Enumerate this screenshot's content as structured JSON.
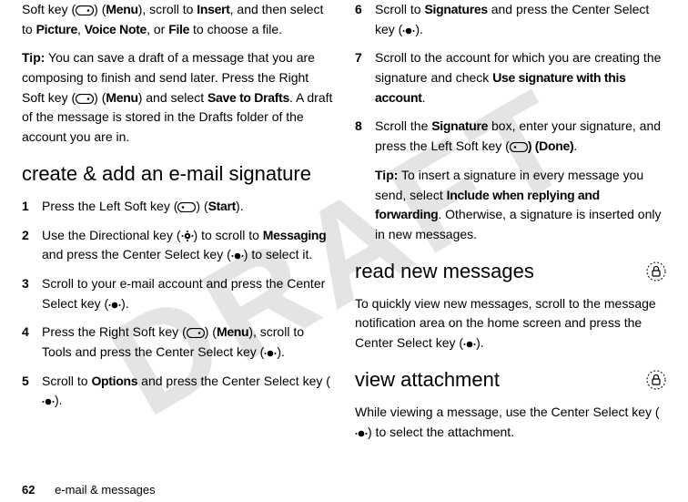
{
  "watermark": "DRAFT",
  "left": {
    "top_continuation": "Soft key (",
    "top_continuation_after_icon": ") (",
    "menu_label": "Menu",
    "top_continuation2": "), scroll to  ",
    "insert_label": "Insert",
    "top_continuation3": ", and then select to ",
    "picture_label": "Picture",
    "voice_note_label": "Voice Note",
    "file_label": "File",
    "top_continuation4": " to choose a file.",
    "tip_label": "Tip:",
    "tip_body_pre": " You can save a draft of a message that you are composing to finish and send later. Press the Right Soft key (",
    "tip_body_mid1": ") (",
    "tip_body_mid2": ") and select ",
    "save_drafts_label": "Save to Drafts",
    "tip_body_end": ". A draft of the message is stored in the Drafts folder of the account you are in.",
    "section_heading": "create & add an e-mail signature",
    "steps": {
      "s1_pre": "Press the Left Soft key (",
      "s1_mid": ") (",
      "start_label": "Start",
      "s1_end": ").",
      "s2_pre": "Use the Directional key (",
      "s2_mid1": ") to scroll to ",
      "messaging_label": "Messaging",
      "s2_mid2": " and press the Center Select key (",
      "s2_end": ") to select it.",
      "s3_pre": "Scroll to your e-mail account and press the Center Select key (",
      "s3_end": ").",
      "s4_pre": "Press the Right Soft key (",
      "s4_mid1": ") (",
      "s4_mid2": "), scroll to Tools and press the Center Select key (",
      "s4_end": ").",
      "s5_pre": "Scroll to ",
      "options_label": "Options",
      "s5_mid": " and press the Center Select key (",
      "s5_end": ")."
    }
  },
  "right": {
    "steps": {
      "s6_pre": "Scroll to ",
      "signatures_label": "Signatures",
      "s6_mid": " and press the Center Select key (",
      "s6_end": ").",
      "s7_pre": "Scroll to the account for which you are creating the signature and check ",
      "use_sig_label": "Use signature with this account",
      "s7_end": ".",
      "s8_pre": "Scroll the ",
      "signature_label": "Signature",
      "s8_mid": " box, enter your signature, and press the Left Soft key (",
      "done_label": ") (Done)",
      "s8_end": "."
    },
    "tip_label": "Tip:",
    "tip_body_pre": " To insert a signature in every message you send, select ",
    "include_label": "Include when replying and forwarding",
    "tip_body_end": ". Otherwise, a signature is inserted only in new messages.",
    "read_heading": "read new messages",
    "read_body_pre": "To quickly view new messages, scroll to the message notification area on the home screen and press the Center Select key (",
    "read_body_end": ").",
    "view_heading": "view attachment",
    "view_body_pre": "While viewing a message, use the Center Select key (",
    "view_body_end": ") to select the attachment."
  },
  "footer": {
    "page_number": "62",
    "section": "e-mail & messages"
  },
  "step_numbers": {
    "n1": "1",
    "n2": "2",
    "n3": "3",
    "n4": "4",
    "n5": "5",
    "n6": "6",
    "n7": "7",
    "n8": "8"
  }
}
